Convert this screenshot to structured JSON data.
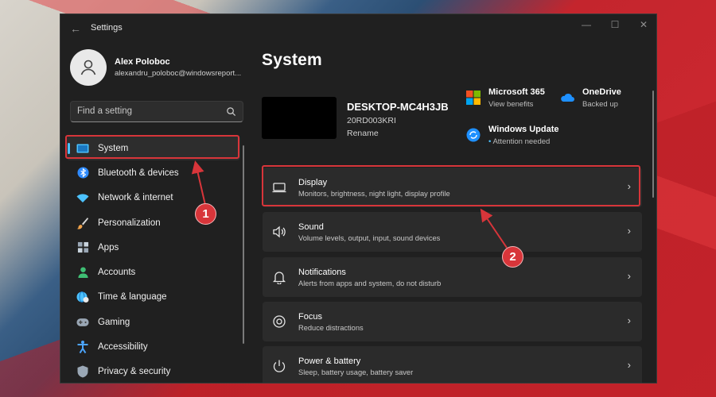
{
  "window": {
    "title": "Settings"
  },
  "user": {
    "name": "Alex Polob​oc",
    "email": "alexandru_poloboc@windowsreport..."
  },
  "search": {
    "placeholder": "Find a setting"
  },
  "nav": [
    {
      "label": "System",
      "icon": "display-icon",
      "color": "#4cc2ff"
    },
    {
      "label": "Bluetooth & devices",
      "icon": "bluetooth-icon",
      "color": "#2f8bff"
    },
    {
      "label": "Network & internet",
      "icon": "wifi-icon",
      "color": "#4cc2ff"
    },
    {
      "label": "Personalization",
      "icon": "brush-icon",
      "color": "#f0a24a"
    },
    {
      "label": "Apps",
      "icon": "apps-icon",
      "color": "#9aa7b5"
    },
    {
      "label": "Accounts",
      "icon": "accounts-icon",
      "color": "#3fbf74"
    },
    {
      "label": "Time & language",
      "icon": "globe-clock-icon",
      "color": "#4cc2ff"
    },
    {
      "label": "Gaming",
      "icon": "gamepad-icon",
      "color": "#9aa7b5"
    },
    {
      "label": "Accessibility",
      "icon": "accessibility-icon",
      "color": "#4ca5ff"
    },
    {
      "label": "Privacy & security",
      "icon": "shield-icon",
      "color": "#9aa7b5"
    }
  ],
  "main": {
    "title": "System",
    "device": {
      "name": "DESKTOP-MC4H3JB",
      "model": "20RD003KRI",
      "rename": "Rename"
    },
    "services": [
      {
        "title": "Microsoft 365",
        "sub": "View benefits",
        "icon": "microsoft365-icon"
      },
      {
        "title": "OneDrive",
        "sub": "Backed up",
        "icon": "onedrive-icon"
      },
      {
        "title": "Windows Update",
        "sub": "Attention needed",
        "icon": "windows-update-icon"
      }
    ],
    "cards": [
      {
        "title": "Display",
        "sub": "Monitors, brightness, night light, display profile",
        "icon": "monitor-icon"
      },
      {
        "title": "Sound",
        "sub": "Volume levels, output, input, sound devices",
        "icon": "speaker-icon"
      },
      {
        "title": "Notifications",
        "sub": "Alerts from apps and system, do not disturb",
        "icon": "bell-icon"
      },
      {
        "title": "Focus",
        "sub": "Reduce distractions",
        "icon": "focus-icon"
      },
      {
        "title": "Power & battery",
        "sub": "Sleep, battery usage, battery saver",
        "icon": "power-icon"
      }
    ]
  },
  "annotations": {
    "step1": "1",
    "step2": "2",
    "color": "#d8353a"
  }
}
